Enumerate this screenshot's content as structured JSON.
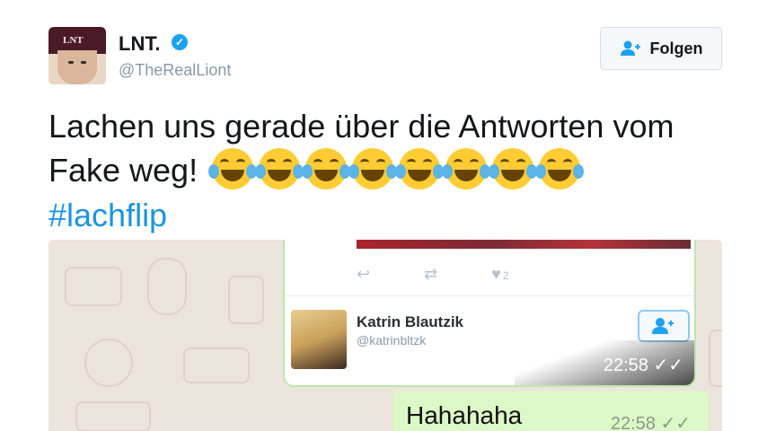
{
  "author": {
    "display_name": "LNT.",
    "handle": "@TheRealLiont",
    "avatar_beanie_text": "LNT"
  },
  "follow_button": {
    "label": "Folgen"
  },
  "tweet": {
    "text_line": "Lachen uns gerade über die Antworten vom Fake weg!",
    "emoji_name": "face-with-tears-of-joy",
    "emoji_count": 8,
    "hashtag": "#lachflip"
  },
  "media": {
    "embedded_card": {
      "like_count": "2",
      "user_name": "Katrin Blautzik",
      "user_handle": "@katrinbltzk",
      "time": "22:58 ✓✓"
    },
    "chat_message": {
      "text": "Hahahaha",
      "time": "22:58 ✓✓",
      "bubble_color": "#dcf8c6"
    },
    "chat_background": "#ece5dd"
  },
  "colors": {
    "link": "#1b95e0",
    "verified": "#1da1f2",
    "secondary_text": "#8899a6"
  }
}
